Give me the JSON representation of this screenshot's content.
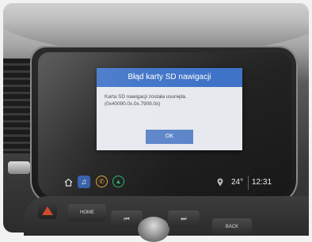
{
  "dialog": {
    "title": "Błąd karty SD nawigacji",
    "message_line1": "Karta SD nawigacji została usunięta.",
    "message_line2": "(0x40090.0x.0x.7909.0x)",
    "ok_label": "OK"
  },
  "status_bar": {
    "temperature": "24°",
    "time": "12:31"
  },
  "hardware_buttons": {
    "home": "HOME",
    "prev": "⏮",
    "next": "⏭",
    "back": "BACK"
  },
  "icons": {
    "home": "home-icon",
    "music": "music-icon",
    "phone": "phone-icon",
    "nav": "navigation-icon",
    "location": "location-pin-icon",
    "hazard": "hazard-icon"
  },
  "colors": {
    "dialog_title_bg": "#3f73c8",
    "ok_button_bg": "#5d86c9",
    "phone_accent": "#e6a526",
    "nav_accent": "#25b56d",
    "hazard_red": "#d24a2a"
  }
}
